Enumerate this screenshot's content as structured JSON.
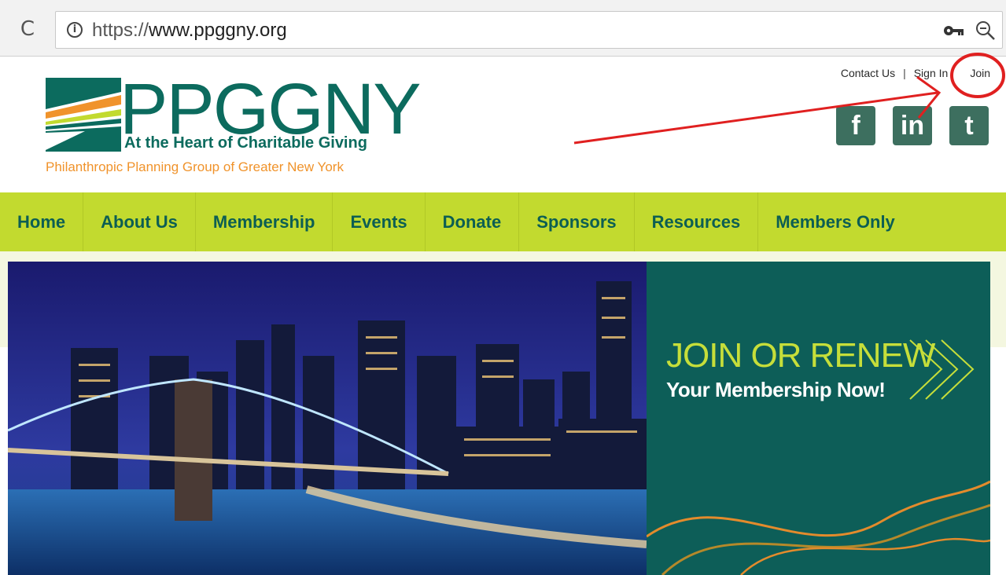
{
  "browser": {
    "url_scheme": "https://",
    "url_host": "www.ppggny.org",
    "reload_glyph": "C",
    "info_glyph": "i"
  },
  "logo": {
    "wordmark": "PPGGNY",
    "tagline": "At the Heart of Charitable Giving",
    "subtitle": "Philanthropic Planning Group of Greater New York"
  },
  "utility_links": {
    "contact": "Contact Us",
    "separator": "|",
    "sign_in": "Sign In",
    "join": "Join"
  },
  "social": {
    "facebook": "f",
    "linkedin": "in",
    "twitter": "t"
  },
  "nav": {
    "items": [
      "Home",
      "About Us",
      "Membership",
      "Events",
      "Donate",
      "Sponsors",
      "Resources",
      "Members Only"
    ]
  },
  "promo": {
    "title": "JOIN OR RENEW",
    "subtitle": "Your Membership Now!"
  },
  "colors": {
    "brand_teal": "#0c6b5e",
    "brand_orange": "#f0932b",
    "nav_green": "#c2da2f",
    "promo_bg": "#0d5e58",
    "promo_accent": "#c6de3a",
    "annotation_red": "#e02020"
  }
}
